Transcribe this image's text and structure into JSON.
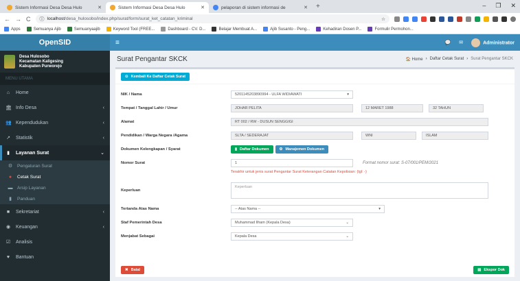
{
  "browser": {
    "tabs": [
      {
        "label": "Sistem Informasi Desa Desa Hulo",
        "active": false
      },
      {
        "label": "Sistem Informasi Desa Desa Hulo",
        "active": true
      },
      {
        "label": "pelaporan di sistem informasi de",
        "active": false
      }
    ],
    "url_host": "localhost",
    "url_path": "/desa_hulosobo/index.php/surat/form/surat_ket_catatan_kriminal",
    "bookmarks": [
      "Apps",
      "Semuanya Ajib",
      "Semuanyaajib",
      "Keyword Tool (FREE...",
      "Dashboard - CV. D...",
      "Belajar Membuat A...",
      "Ajib Susanto - Peng...",
      "Kehadiran Dosen P...",
      "Formulir Permohon..."
    ]
  },
  "app": {
    "logo": "OpenSID",
    "desa_line1": "Desa Hulosobo",
    "desa_line2": "Kecamatan Kaligesing",
    "desa_line3": "Kabupaten Purworejo",
    "menu_header": "MENU UTAMA",
    "menu": [
      {
        "label": "Home",
        "icon": "home-icon",
        "glyph": "⌂"
      },
      {
        "label": "Info Desa",
        "icon": "bank-icon",
        "glyph": "⌂",
        "chev": true
      },
      {
        "label": "Kependudukan",
        "icon": "users-icon",
        "glyph": "☺",
        "chev": true
      },
      {
        "label": "Statistik",
        "icon": "chart-icon",
        "glyph": "↗",
        "chev": true
      }
    ],
    "active_menu": {
      "label": "Layanan Surat",
      "icon": "book-icon",
      "glyph": "■"
    },
    "submenu": [
      {
        "label": "Pengaturan Surat",
        "glyph": "⚙"
      },
      {
        "label": "Cetak Surat",
        "glyph": "●"
      },
      {
        "label": "Arsip Layanan",
        "glyph": "▬"
      },
      {
        "label": "Panduan",
        "glyph": "▮"
      }
    ],
    "menu_bottom": [
      {
        "label": "Sekretariat",
        "icon": "folder-icon",
        "glyph": "■",
        "chev": true
      },
      {
        "label": "Keuangan",
        "icon": "money-icon",
        "glyph": "◉",
        "chev": true
      },
      {
        "label": "Analisis",
        "icon": "check-icon",
        "glyph": "☑"
      },
      {
        "label": "Bantuan",
        "icon": "heart-icon",
        "glyph": "♥"
      }
    ],
    "user": "Administrator",
    "page_title": "Surat Pengantar SKCK",
    "breadcrumb": {
      "home": "Home",
      "mid": "Daftar Cetak Surat",
      "current": "Surat Pengantar SKCK"
    },
    "back_button": "Kembali Ke Daftar Cetak Surat"
  },
  "form": {
    "nik_label": "NIK / Nama",
    "nik_value": "5201145203890994 - ULFA WIDIAWATI",
    "ttl_label": "Tempat / Tanggal Lahir / Umur",
    "tempat": "JOHAR PELITA",
    "tanggal": "12 MARET 1988",
    "umur": "32 TAHUN",
    "alamat_label": "Alamat",
    "alamat": "RT 002 / RW - DUSUN SENGGIGI",
    "pend_label": "Pendidikan / Warga Negara /Agama",
    "pendidikan": "SLTA / SEDERAJAT",
    "wn": "WNI",
    "agama": "ISLAM",
    "dok_label": "Dokumen Kelengkapan / Syarat",
    "dok_btn1": "Daftar Dokumen",
    "dok_btn2": "Manajemen Dokumen",
    "nomor_label": "Nomor Surat",
    "nomor_value": "1",
    "nomor_hint": "Format nomor surat: S-07/001/PEM/2021",
    "nomor_note": "Terakhir untuk jenis surat Pengantar Surat Keterangan Catatan Kepolisian: (tgl: -)",
    "keperluan_label": "Keperluan",
    "keperluan_placeholder": "Keperluan",
    "ttd_label": "Tertanda Atas Nama",
    "ttd_value": "-- Atas Nama --",
    "staf_label": "Staf Pemerintah Desa",
    "staf_value": "Muhammad Ilham (Kepala Desa)",
    "sebagai_label": "Menjabat Sebagai",
    "sebagai_value": "Kepala Desa",
    "batal": "Batal",
    "ekspor": "Ekspor Dok"
  },
  "colors": {
    "topbar": "#3c8dbc",
    "sidebar": "#222d32",
    "accent": "#00a65a"
  }
}
